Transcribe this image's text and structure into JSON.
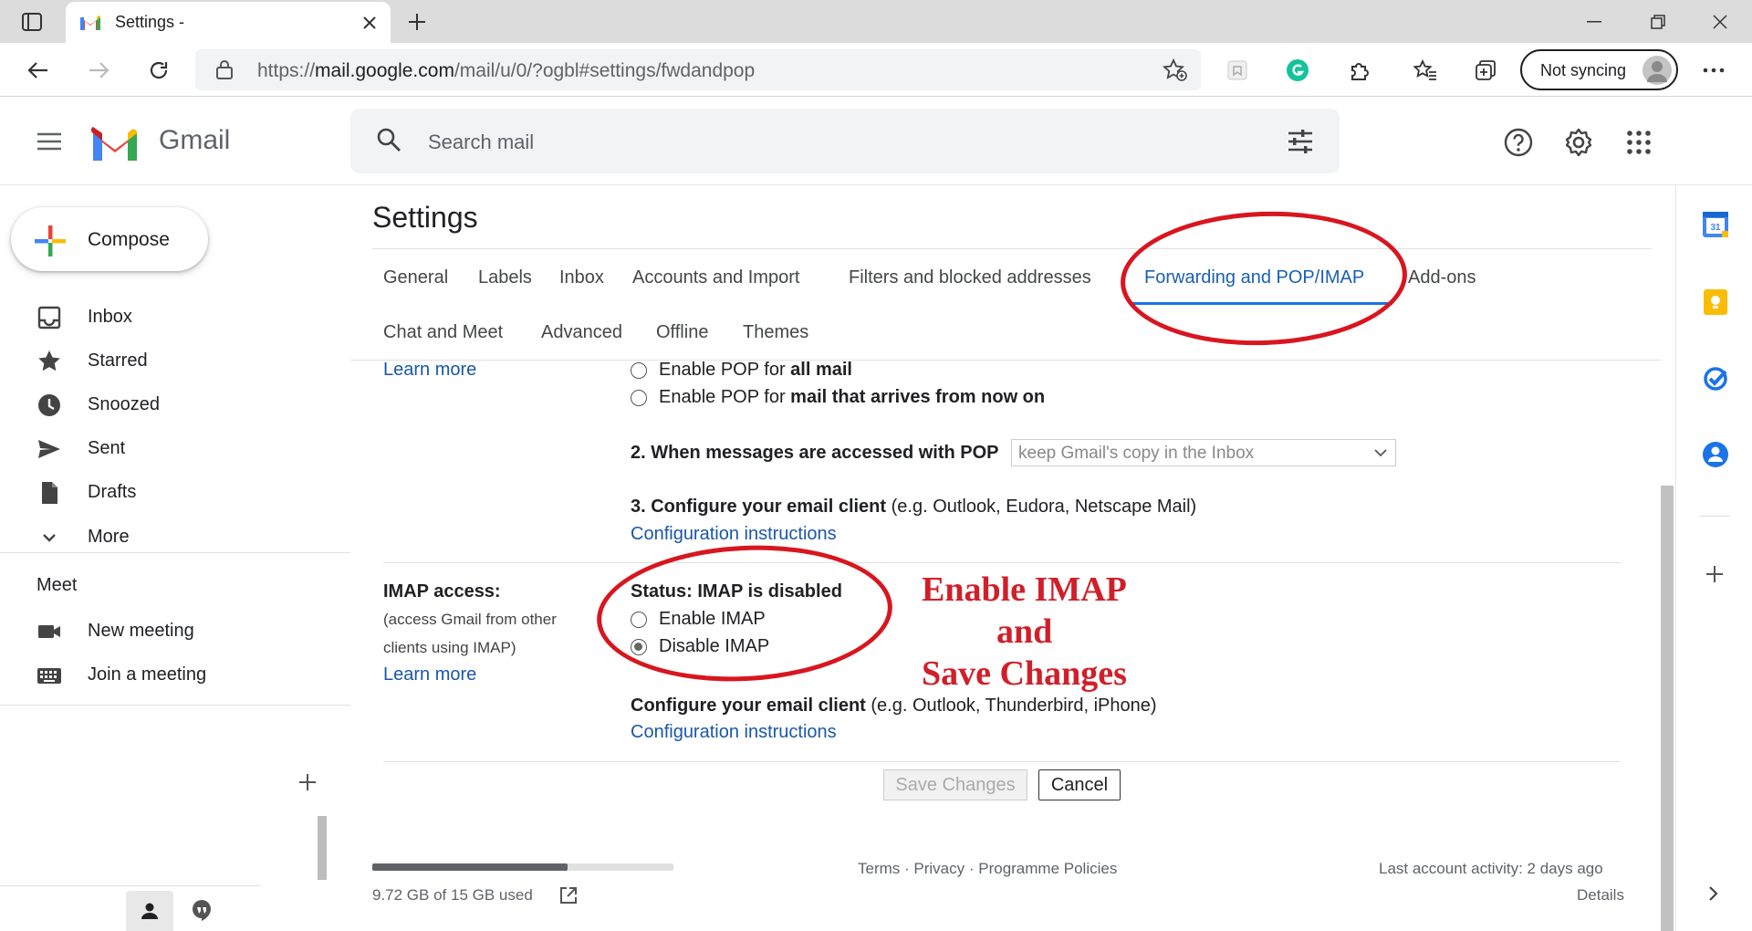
{
  "browser": {
    "tab_title": "Settings -",
    "url_prefix": "https://",
    "url_host": "mail.google.com",
    "url_path": "/mail/u/0/?ogbl#settings/fwdandpop",
    "sync_label": "Not syncing"
  },
  "header": {
    "app_name": "Gmail",
    "search_placeholder": "Search mail"
  },
  "sidebar": {
    "compose_label": "Compose",
    "items": [
      {
        "label": "Inbox",
        "icon": "inbox-icon"
      },
      {
        "label": "Starred",
        "icon": "star-icon"
      },
      {
        "label": "Snoozed",
        "icon": "clock-icon"
      },
      {
        "label": "Sent",
        "icon": "send-icon"
      },
      {
        "label": "Drafts",
        "icon": "draft-icon"
      },
      {
        "label": "More",
        "icon": "chevron-down-icon"
      }
    ],
    "meet": {
      "heading": "Meet",
      "new_meeting": "New meeting",
      "join_meeting": "Join a meeting"
    }
  },
  "settings": {
    "title": "Settings",
    "tabs_row1": [
      "General",
      "Labels",
      "Inbox",
      "Accounts and Import",
      "Filters and blocked addresses",
      "Forwarding and POP/IMAP",
      "Add-ons"
    ],
    "tabs_row2": [
      "Chat and Meet",
      "Advanced",
      "Offline",
      "Themes"
    ],
    "pop": {
      "learn_more": "Learn more",
      "opt_all_prefix": "Enable POP for ",
      "opt_all_bold": "all mail",
      "opt_now_prefix": "Enable POP for ",
      "opt_now_bold": "mail that arrives from now on",
      "step2_label": "2. When messages are accessed with POP",
      "step2_select": "keep Gmail's copy in the Inbox",
      "step3_label": "3. Configure your email client",
      "step3_hint": " (e.g. Outlook, Eudora, Netscape Mail)",
      "config_link": "Configuration instructions"
    },
    "imap": {
      "heading": "IMAP access:",
      "desc_line1": "(access Gmail from other",
      "desc_line2": "clients using IMAP)",
      "learn_more": "Learn more",
      "status": "Status: IMAP is disabled",
      "enable": "Enable IMAP",
      "disable": "Disable IMAP",
      "selected": "disable",
      "client_label": "Configure your email client",
      "client_hint": " (e.g. Outlook, Thunderbird, iPhone)",
      "config_link": "Configuration instructions"
    },
    "save_label": "Save Changes",
    "cancel_label": "Cancel"
  },
  "annotation": {
    "line1": "Enable IMAP",
    "line2": "and",
    "line3": "Save Changes",
    "color": "#d11f2a"
  },
  "footer": {
    "storage_text": "9.72 GB of 15 GB used",
    "storage_fraction": 0.648,
    "terms": "Terms",
    "privacy": "Privacy",
    "policies": "Programme Policies",
    "sep": " · ",
    "activity": "Last account activity: 2 days ago",
    "details": "Details"
  }
}
